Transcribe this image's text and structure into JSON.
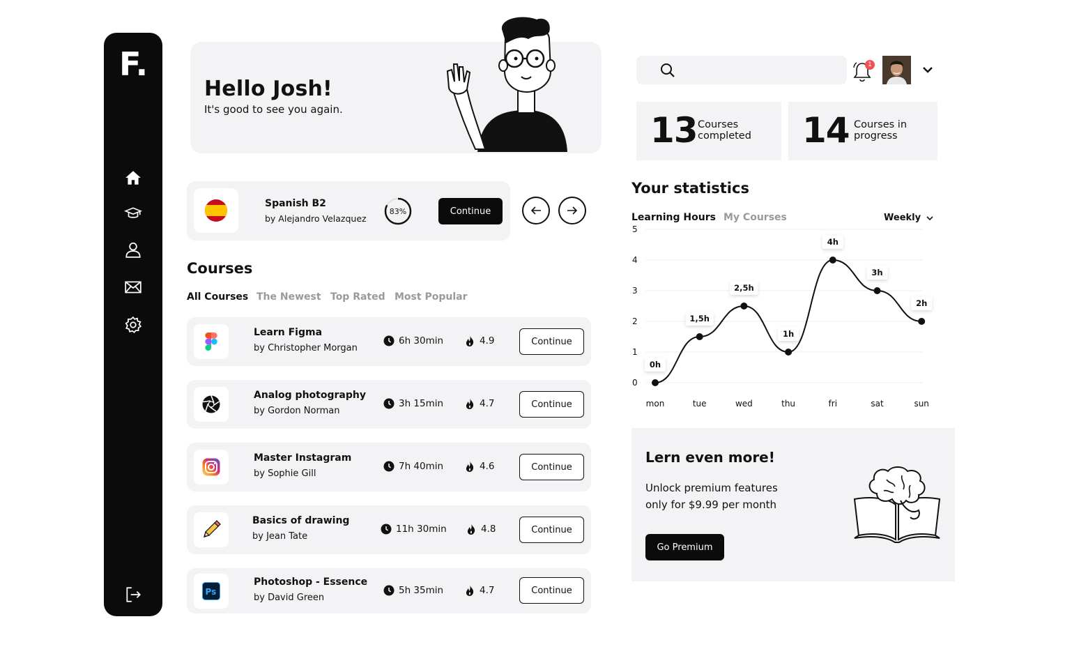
{
  "sidebar": {
    "logo": "F.",
    "items": [
      {
        "name": "home-icon"
      },
      {
        "name": "graduation-cap-icon"
      },
      {
        "name": "user-icon"
      },
      {
        "name": "mail-icon"
      },
      {
        "name": "settings-icon"
      }
    ],
    "logout": "logout-icon"
  },
  "hello": {
    "title": "Hello Josh!",
    "subtitle": "It's good to see you again."
  },
  "current_course": {
    "title": "Spanish B2",
    "author": "by Alejandro Velazquez",
    "progress_label": "83%",
    "progress": 0.83,
    "button": "Continue"
  },
  "courses": {
    "title": "Courses",
    "tabs": [
      "All Courses",
      "The Newest",
      "Top Rated",
      "Most Popular"
    ],
    "continue_label": "Continue",
    "rows": [
      {
        "title": "Learn Figma",
        "author": "by Christopher Morgan",
        "time": "6h 30min",
        "rating": "4.9",
        "icon": "figma-icon"
      },
      {
        "title": "Analog photography",
        "author": "by Gordon Norman",
        "time": "3h 15min",
        "rating": "4.7",
        "icon": "aperture-icon"
      },
      {
        "title": "Master Instagram",
        "author": "by Sophie Gill",
        "time": "7h 40min",
        "rating": "4.6",
        "icon": "instagram-icon"
      },
      {
        "title": "Basics of drawing",
        "author": "by Jean Tate",
        "time": "11h 30min",
        "rating": "4.8",
        "icon": "pencil-icon"
      },
      {
        "title": "Photoshop - Essence",
        "author": "by David Green",
        "time": "5h 35min",
        "rating": "4.7",
        "icon": "photoshop-icon"
      }
    ]
  },
  "header": {
    "search_placeholder": "",
    "notifications": "1"
  },
  "stats": {
    "completed_num": "13",
    "completed_label": "Courses completed",
    "progress_num": "14",
    "progress_label": "Courses in progress"
  },
  "statistics": {
    "title": "Your statistics",
    "tabs": [
      "Learning Hours",
      "My Courses"
    ],
    "period": "Weekly"
  },
  "chart_data": {
    "type": "line",
    "categories": [
      "mon",
      "tue",
      "wed",
      "thu",
      "fri",
      "sat",
      "sun"
    ],
    "values": [
      0,
      1.5,
      2.5,
      1,
      4,
      3,
      2
    ],
    "labels": [
      "0h",
      "1,5h",
      "2,5h",
      "1h",
      "4h",
      "3h",
      "2h"
    ],
    "yticks": [
      "0",
      "1",
      "2",
      "3",
      "4",
      "5"
    ],
    "ylim": [
      0,
      5
    ],
    "grid": true
  },
  "premium": {
    "title": "Lern even more!",
    "text": "Unlock premium features only for $9.99 per month",
    "button": "Go Premium"
  },
  "colors": {
    "dark": "#0b0b0b",
    "panel": "#f3f3f5",
    "badge": "#f0525a",
    "flag_red": "#c60b1e",
    "flag_yellow": "#ffc400"
  }
}
